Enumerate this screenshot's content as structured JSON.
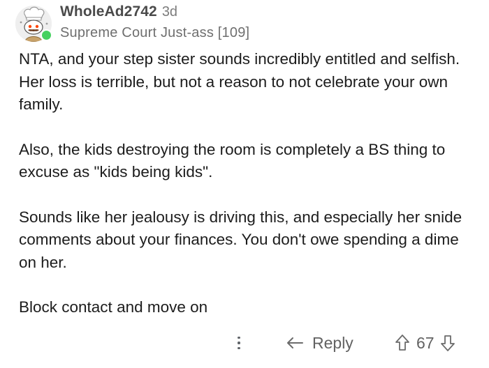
{
  "comment": {
    "username": "WholeAd2742",
    "age": "3d",
    "flair": "Supreme Court Just-ass [109]",
    "paragraphs": [
      "NTA, and your step sister sounds incredibly entitled and selfish. Her loss is terrible, but not a reason to not celebrate your own family.",
      "Also, the kids destroying the room is completely a BS thing to excuse as \"kids being kids\".",
      "Sounds like her jealousy is driving this, and especially her snide comments about your finances. You don't owe spending a dime on her.",
      "Block contact and move on"
    ],
    "online_status_color": "#46d160"
  },
  "actions": {
    "reply_label": "Reply",
    "vote_count": "67",
    "icons": {
      "more": "more-vertical-icon",
      "reply": "reply-arrow-icon",
      "upvote": "upvote-arrow-icon",
      "downvote": "downvote-arrow-icon"
    }
  }
}
